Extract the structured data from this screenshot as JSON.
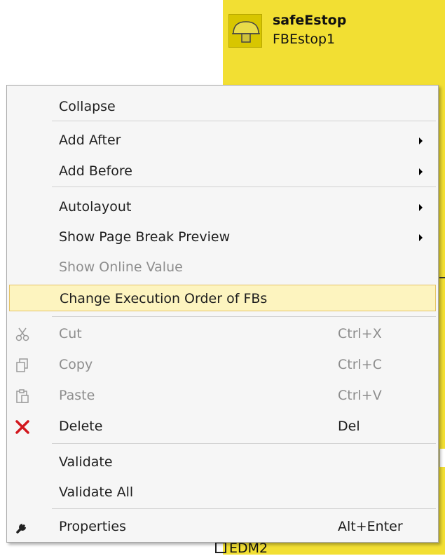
{
  "function_block": {
    "name": "safeEstop",
    "instance": "FBEstop1",
    "icon": "estop-mushroom-icon",
    "color": "#f2df33"
  },
  "diagram": {
    "edm_label": "EDM2"
  },
  "context_menu": {
    "highlight_color": "#fdf4bf",
    "items": [
      {
        "label": "Collapse",
        "shortcut": "",
        "icon": "",
        "submenu": false,
        "disabled": false,
        "highlighted": false
      },
      {
        "label": "Add After",
        "shortcut": "",
        "icon": "",
        "submenu": true,
        "disabled": false,
        "highlighted": false
      },
      {
        "label": "Add Before",
        "shortcut": "",
        "icon": "",
        "submenu": true,
        "disabled": false,
        "highlighted": false
      },
      {
        "label": "Autolayout",
        "shortcut": "",
        "icon": "",
        "submenu": true,
        "disabled": false,
        "highlighted": false
      },
      {
        "label": "Show Page Break Preview",
        "shortcut": "",
        "icon": "",
        "submenu": true,
        "disabled": false,
        "highlighted": false
      },
      {
        "label": "Show Online Value",
        "shortcut": "",
        "icon": "",
        "submenu": false,
        "disabled": true,
        "highlighted": false
      },
      {
        "label": "Change Execution Order of FBs",
        "shortcut": "",
        "icon": "",
        "submenu": false,
        "disabled": false,
        "highlighted": true
      },
      {
        "label": "Cut",
        "shortcut": "Ctrl+X",
        "icon": "scissors-icon",
        "submenu": false,
        "disabled": true,
        "highlighted": false
      },
      {
        "label": "Copy",
        "shortcut": "Ctrl+C",
        "icon": "copy-icon",
        "submenu": false,
        "disabled": true,
        "highlighted": false
      },
      {
        "label": "Paste",
        "shortcut": "Ctrl+V",
        "icon": "paste-icon",
        "submenu": false,
        "disabled": true,
        "highlighted": false
      },
      {
        "label": "Delete",
        "shortcut": "Del",
        "icon": "delete-x-icon",
        "submenu": false,
        "disabled": false,
        "highlighted": false
      },
      {
        "label": "Validate",
        "shortcut": "",
        "icon": "",
        "submenu": false,
        "disabled": false,
        "highlighted": false
      },
      {
        "label": "Validate All",
        "shortcut": "",
        "icon": "",
        "submenu": false,
        "disabled": false,
        "highlighted": false
      },
      {
        "label": "Properties",
        "shortcut": "Alt+Enter",
        "icon": "wrench-icon",
        "submenu": false,
        "disabled": false,
        "highlighted": false
      }
    ]
  }
}
